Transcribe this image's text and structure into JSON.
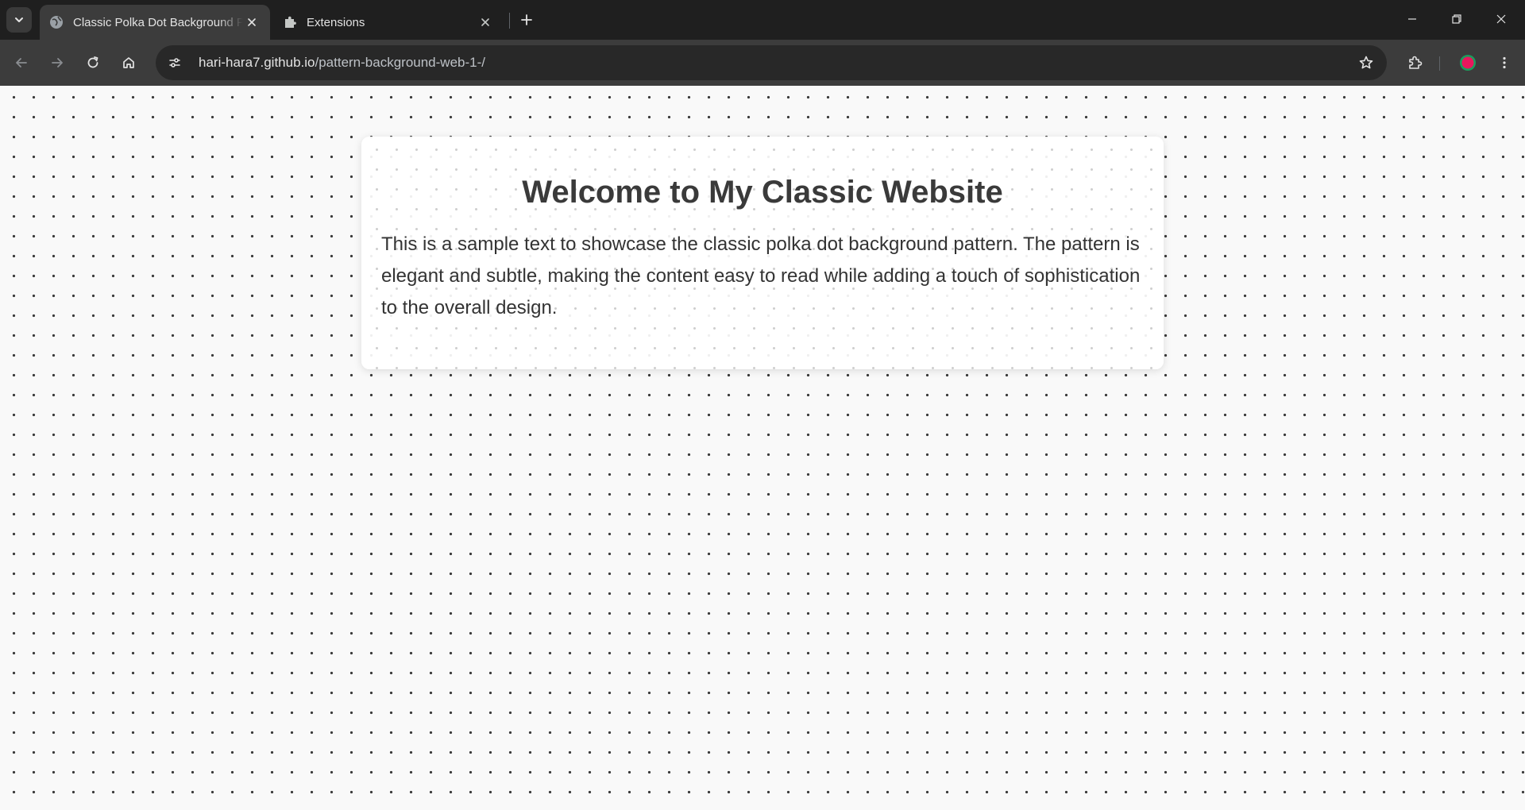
{
  "browser": {
    "tabs": [
      {
        "title": "Classic Polka Dot Background Pattern",
        "active": true
      },
      {
        "title": "Extensions",
        "active": false
      }
    ],
    "url": {
      "host": "hari-hara7.github.io",
      "path": "/pattern-background-web-1-/"
    },
    "profile_color": "#e8175d"
  },
  "page": {
    "heading": "Welcome to My Classic Website",
    "body_text": "This is a sample text to showcase the classic polka dot background pattern. The pattern is elegant and subtle, making the content easy to read while adding a touch of sophistication to the overall design."
  }
}
